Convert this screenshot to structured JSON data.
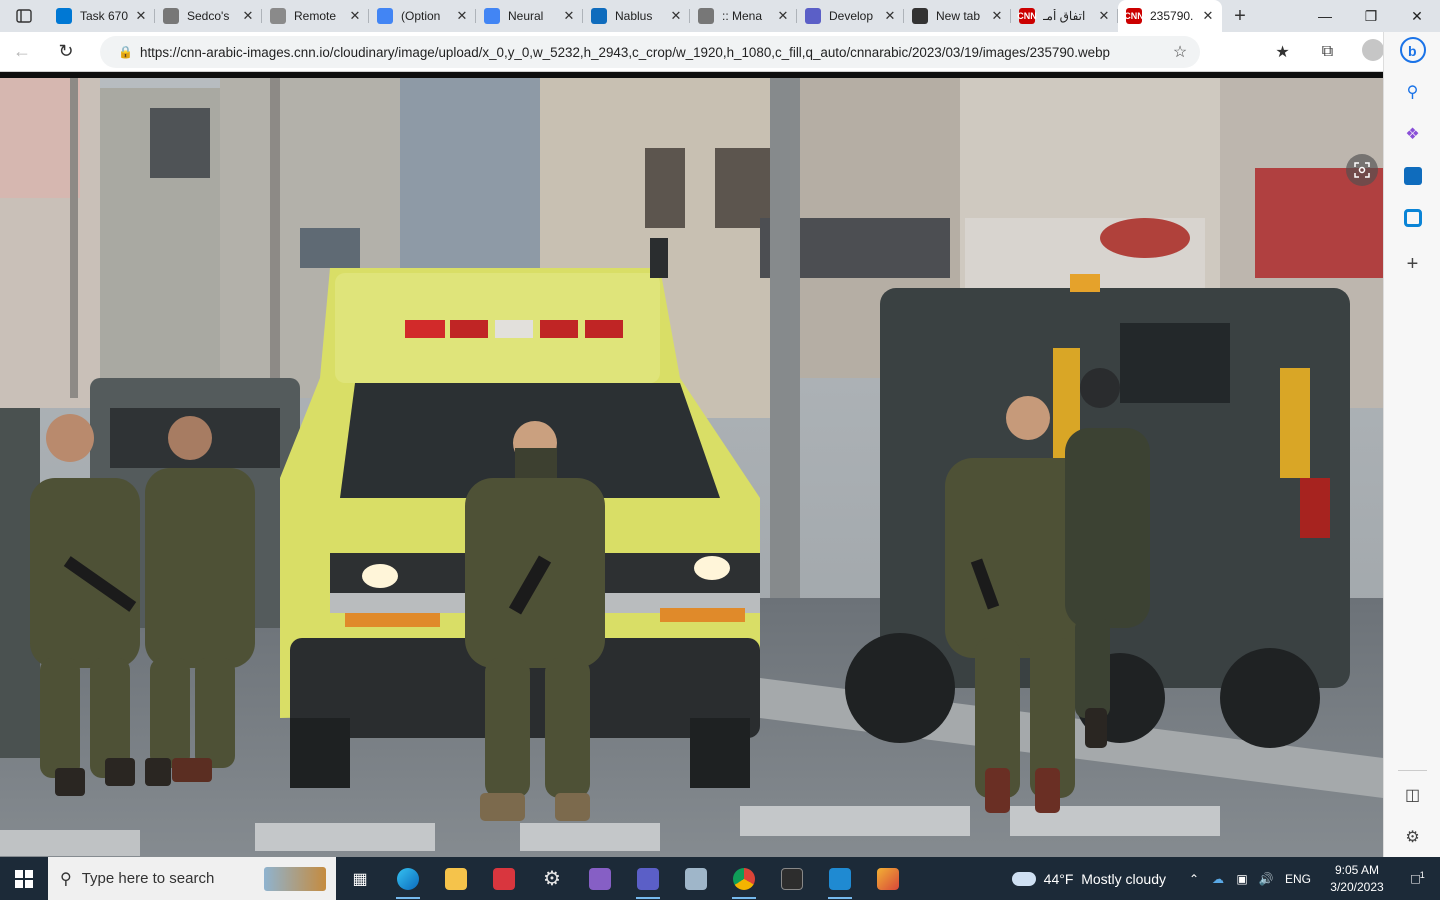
{
  "browser": {
    "tabs": [
      {
        "title": "Task 670",
        "icon": "azure-devops-icon",
        "color": "#0078d4"
      },
      {
        "title": "Sedco's",
        "icon": "page-icon",
        "color": "#777777"
      },
      {
        "title": "Remote",
        "icon": "remote-desktop-icon",
        "color": "#8a8a8a"
      },
      {
        "title": "(Option",
        "icon": "chrome-c-icon",
        "color": "#4285f4"
      },
      {
        "title": "Neural",
        "icon": "chrome-c-icon",
        "color": "#4285f4"
      },
      {
        "title": "Nablus",
        "icon": "outlook-icon",
        "color": "#0f6cbd"
      },
      {
        "title": ":: Mena",
        "icon": "page-icon",
        "color": "#777777"
      },
      {
        "title": "Develop",
        "icon": "teams-icon",
        "color": "#5b5fc7"
      },
      {
        "title": "New tab",
        "icon": "new-tab-icon",
        "color": "#333333"
      },
      {
        "title": "اتفاق أمـ",
        "icon": "cnn-icon",
        "color": "#cc0000"
      },
      {
        "title": "235790.",
        "icon": "cnn-icon",
        "color": "#cc0000",
        "active": true
      }
    ],
    "url": "https://cnn-arabic-images.cnn.io/cloudinary/image/upload/x_0,y_0,w_5232,h_2943,c_crop/w_1920,h_1080,c_fill,q_auto/cnnarabic/2023/03/19/images/235790.webp",
    "cnn_badge": "CNN"
  },
  "taskbar": {
    "search_placeholder": "Type here to search",
    "weather_temp": "44°F",
    "weather_text": "Mostly cloudy",
    "language": "ENG",
    "time": "9:05 AM",
    "date": "3/20/2023",
    "notification_count": "1"
  }
}
